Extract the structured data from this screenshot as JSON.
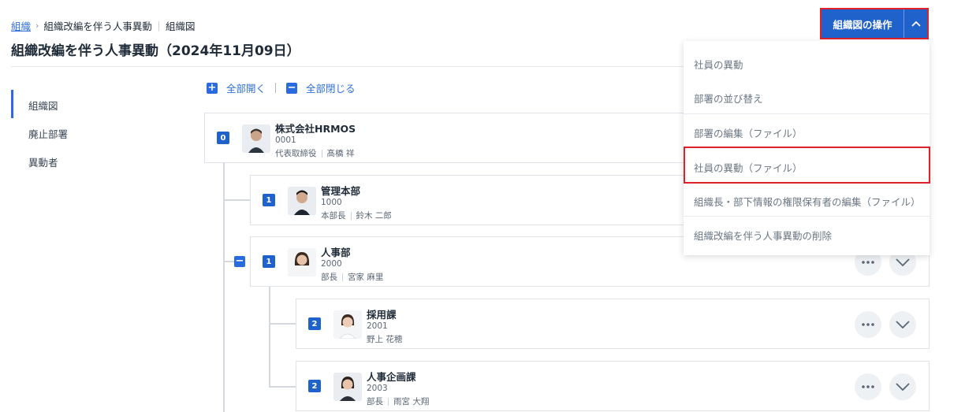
{
  "breadcrumb": {
    "root": "組織",
    "current": "組織改編を伴う人事異動",
    "view": "組織図"
  },
  "page": {
    "title": "組織改編を伴う人事異動（2024年11月09日）"
  },
  "sidebar": {
    "items": [
      {
        "label": "組織図",
        "active": true
      },
      {
        "label": "廃止部署"
      },
      {
        "label": "異動者"
      }
    ]
  },
  "tree_controls": {
    "expand_all": "全部開く",
    "collapse_all": "全部閉じる",
    "expand_icon": "plus-square-icon",
    "collapse_icon": "minus-square-icon"
  },
  "operations": {
    "button_label": "組織図の操作",
    "toggle_icon": "chevron-up-icon",
    "menu": [
      "社員の異動",
      "部署の並び替え",
      "部署の編集（ファイル）",
      "社員の異動（ファイル）",
      "組織長・部下情報の権限保有者の編集（ファイル）",
      "組織改編を伴う人事異動の削除"
    ],
    "highlighted_item": "社員の異動（ファイル）"
  },
  "org_units": [
    {
      "level": "0",
      "name": "株式会社HRMOS",
      "code": "0001",
      "role": "代表取締役",
      "person": "髙橋 祥"
    },
    {
      "level": "1",
      "name": "管理本部",
      "code": "1000",
      "role": "本部長",
      "person": "鈴木 二郎"
    },
    {
      "level": "1",
      "name": "人事部",
      "code": "2000",
      "role": "部長",
      "person": "宮家 麻里"
    },
    {
      "level": "2",
      "name": "採用課",
      "code": "2001",
      "role": "",
      "person": "野上 花穂"
    },
    {
      "level": "2",
      "name": "人事企画課",
      "code": "2003",
      "role": "部長",
      "person": "雨宮 大翔"
    }
  ],
  "colors": {
    "primary": "#2062cc",
    "link": "#2f6fd9",
    "highlight_outline": "#e0212a"
  }
}
